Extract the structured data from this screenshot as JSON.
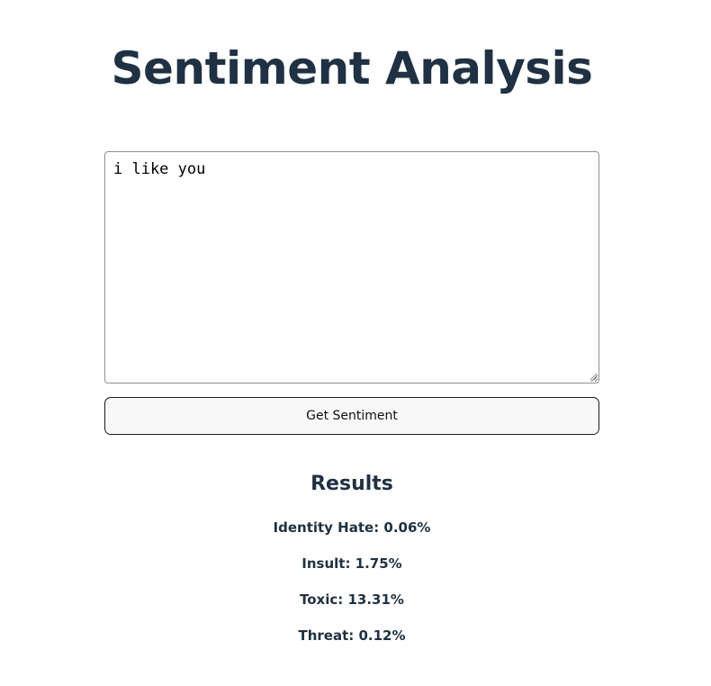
{
  "page": {
    "title": "Sentiment Analysis"
  },
  "input": {
    "value": "i like you"
  },
  "button": {
    "label": "Get Sentiment"
  },
  "results": {
    "heading": "Results",
    "items": [
      {
        "text": "Identity Hate: 0.06%"
      },
      {
        "text": "Insult: 1.75%"
      },
      {
        "text": "Toxic: 13.31%"
      },
      {
        "text": "Threat: 0.12%"
      }
    ]
  },
  "colors": {
    "heading": "#1f3142",
    "button_bg": "#f8f8f8",
    "button_border": "#1c1c1c",
    "textarea_border": "#8f8f8f"
  }
}
